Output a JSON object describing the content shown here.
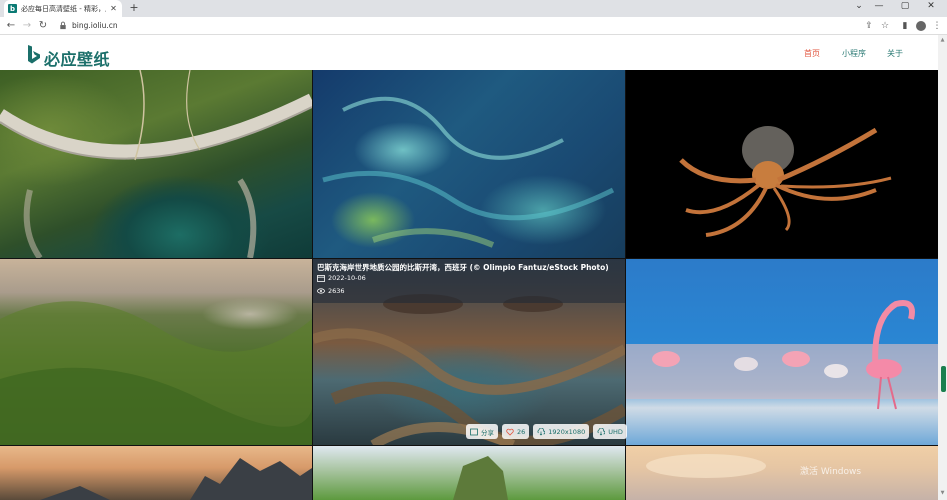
{
  "browser": {
    "tab_title": "必应每日高清壁纸 - 精彩，从这里开始",
    "tab_favicon": "b",
    "new_tab": "+",
    "tab_close": "✕",
    "url": "bing.ioliu.cn",
    "window_controls": [
      "⌄",
      "—",
      "▢",
      "✕"
    ]
  },
  "site": {
    "logo_text": "必应壁纸",
    "nav": [
      {
        "label": "首页",
        "active": true
      },
      {
        "label": "小程序",
        "active": false
      },
      {
        "label": "关于",
        "active": false
      }
    ]
  },
  "featured": {
    "caption": "巴斯克海岸世界地质公园的比斯开湾，西班牙 (© Olimpio Fantuz/eStock Photo)",
    "date": "2022-10-06",
    "views": "2636",
    "actions": [
      {
        "label": "分享",
        "icon": "share-icon"
      },
      {
        "label": "26",
        "icon": "heart-icon"
      },
      {
        "label": "1920x1080",
        "icon": "download-icon"
      },
      {
        "label": "UHD",
        "icon": "download-icon"
      }
    ]
  },
  "watermark": "激活 Windows",
  "colors": {
    "brand": "#1b6f6a",
    "nav_active": "#e2563f",
    "scroll_thumb": "#1b7f4f"
  }
}
